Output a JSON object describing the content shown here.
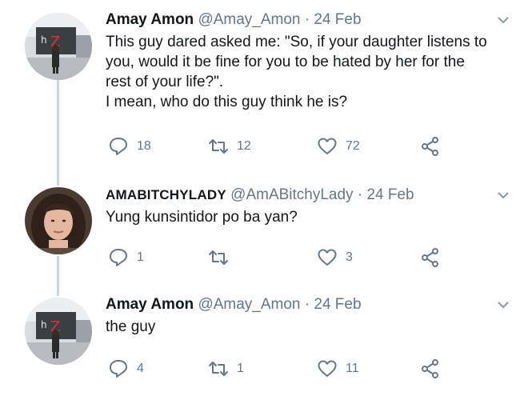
{
  "tweets": [
    {
      "name": "Amay Amon",
      "handle": "@Amay_Amon",
      "separator": "·",
      "date": "24 Feb",
      "lines": [
        "This guy dared asked me: \"So, if your daughter listens to",
        "you, would it be fine for you to be hated by her for the",
        "rest of your life?\".",
        "I mean, who do this guy think he is?"
      ],
      "replies": "18",
      "retweets": "12",
      "likes": "72",
      "avatar": "building-photo-avatar"
    },
    {
      "name": "AMABITCHYLADY",
      "handle": "@AmABitchyLady",
      "separator": "·",
      "date": "24 Feb",
      "lines": [
        "Yung kunsintidor po ba yan?"
      ],
      "replies": "1",
      "retweets": "",
      "likes": "3",
      "avatar": "woman-portrait-avatar"
    },
    {
      "name": "Amay Amon",
      "handle": "@Amay_Amon",
      "separator": "·",
      "date": "24 Feb",
      "lines": [
        "the guy"
      ],
      "replies": "4",
      "retweets": "1",
      "likes": "11",
      "avatar": "building-photo-avatar"
    }
  ],
  "icons": {
    "reply": "reply-icon",
    "retweet": "retweet-icon",
    "like": "heart-icon",
    "share": "share-icon",
    "menu": "chevron-down-icon"
  },
  "colors": {
    "text": "#14171a",
    "muted": "#657786",
    "thread_line": "#ccd6dd",
    "background": "#ffffff"
  }
}
